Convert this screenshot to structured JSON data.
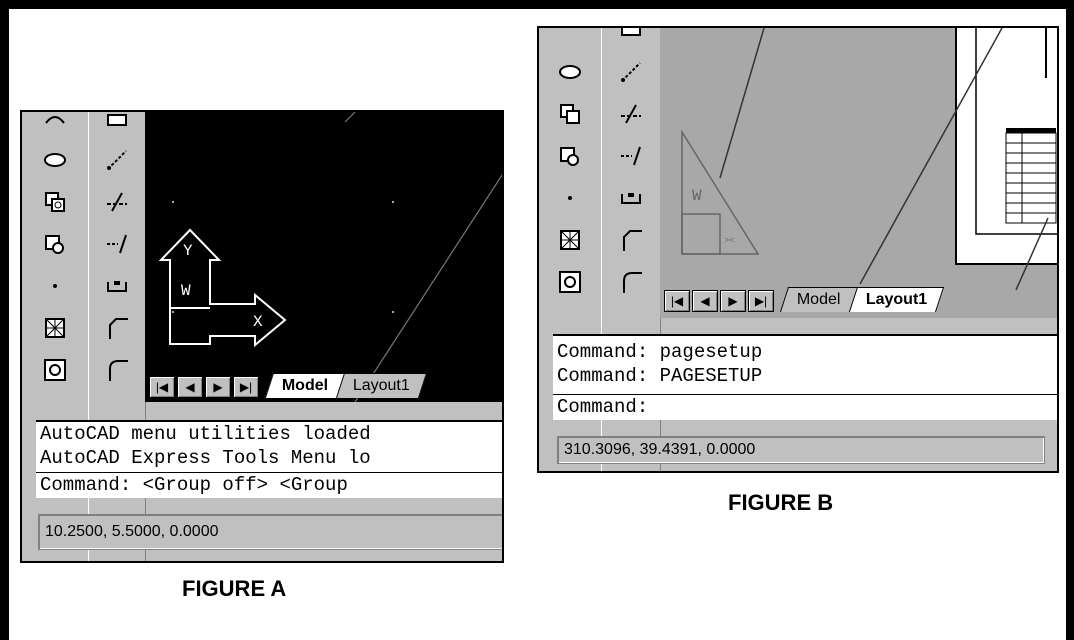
{
  "figure_a": {
    "caption": "FIGURE A",
    "tabs": [
      "Model",
      "Layout1"
    ],
    "command_lines": [
      "AutoCAD menu utilities loaded",
      "AutoCAD Express Tools Menu lo"
    ],
    "prompt": "Command:  <Group off>  <Group",
    "status": "10.2500, 5.5000, 0.0000"
  },
  "figure_b": {
    "caption": "FIGURE B",
    "tabs": [
      "Model",
      "Layout1"
    ],
    "command_lines": [
      "Command: pagesetup",
      "Command:   PAGESETUP"
    ],
    "prompt": "Command:",
    "status": "310.3096, 39.4391, 0.0000"
  },
  "nav_buttons": [
    "first-tab-icon",
    "prev-tab-icon",
    "next-tab-icon",
    "last-tab-icon"
  ],
  "tool_icons": [
    "ellipse-icon",
    "insert-block-icon",
    "make-block-icon",
    "point-icon",
    "hatch-icon",
    "region-icon",
    "construction-line-icon",
    "trim-icon",
    "extend-icon",
    "break-icon",
    "chamfer-icon",
    "fillet-icon"
  ],
  "colors": {
    "viewport_model": "#000000",
    "viewport_layout": "#a8a8a8",
    "toolbar": "#c0c0c0"
  }
}
